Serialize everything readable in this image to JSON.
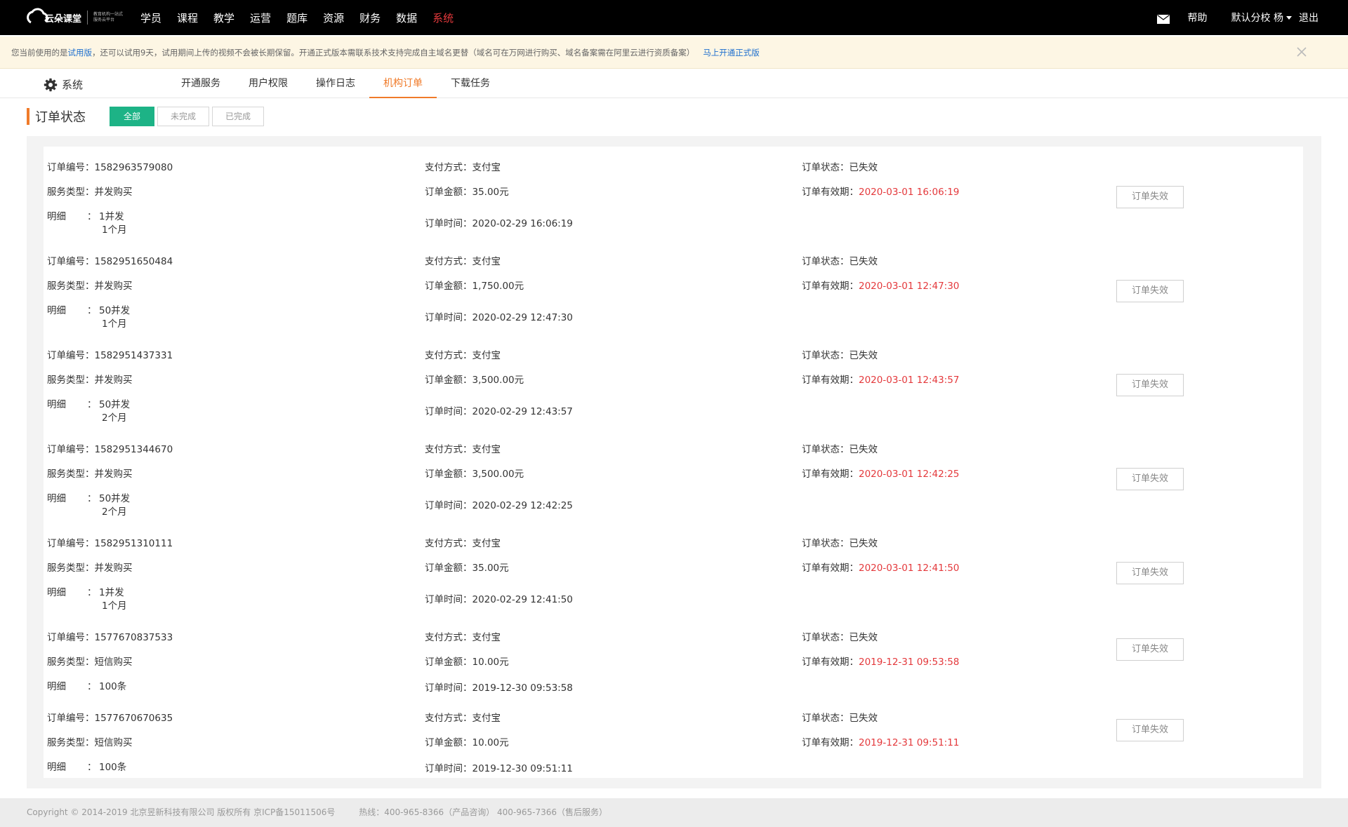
{
  "header": {
    "logo_text": "云朵课堂",
    "logo_slogan": "教育机构一站式服务云平台",
    "nav": [
      "学员",
      "课程",
      "教学",
      "运营",
      "题库",
      "资源",
      "财务",
      "数据",
      "系统"
    ],
    "active_nav": "系统",
    "help": "帮助",
    "school": "默认分校",
    "user": "杨",
    "logout": "退出"
  },
  "notice": {
    "prefix": "您当前使用的是",
    "trial": "试用版",
    "text": "，还可以试用9天，试用期间上传的视频不会被长期保留。开通正式版本需联系技术支持完成自主域名更替（域名可在万网进行购买、域名备案需在阿里云进行资质备案）",
    "upgrade": "马上开通正式版"
  },
  "subnav": {
    "title": "系统",
    "tabs": [
      "开通服务",
      "用户权限",
      "操作日志",
      "机构订单",
      "下载任务"
    ],
    "active_tab": "机构订单"
  },
  "filter": {
    "title": "订单状态",
    "buttons": [
      "全部",
      "未完成",
      "已完成"
    ],
    "active": "全部"
  },
  "labels": {
    "order_no": "订单编号：",
    "service_type": "服务类型：",
    "detail": "明细",
    "detail_colon": "：",
    "pay_method": "支付方式：",
    "amount": "订单金额：",
    "order_time": "订单时间：",
    "status": "订单状态：",
    "valid_until": "订单有效期："
  },
  "orders": [
    {
      "no": "1582963579080",
      "service": "并发购买",
      "detail1": "1并发",
      "detail2": "1个月",
      "pay": "支付宝",
      "amount": "35.00元",
      "time": "2020-02-29 16:06:19",
      "status": "已失效",
      "valid": "2020-03-01 16:06:19",
      "action": "订单失效"
    },
    {
      "no": "1582951650484",
      "service": "并发购买",
      "detail1": "50并发",
      "detail2": "1个月",
      "pay": "支付宝",
      "amount": "1,750.00元",
      "time": "2020-02-29 12:47:30",
      "status": "已失效",
      "valid": "2020-03-01 12:47:30",
      "action": "订单失效"
    },
    {
      "no": "1582951437331",
      "service": "并发购买",
      "detail1": "50并发",
      "detail2": "2个月",
      "pay": "支付宝",
      "amount": "3,500.00元",
      "time": "2020-02-29 12:43:57",
      "status": "已失效",
      "valid": "2020-03-01 12:43:57",
      "action": "订单失效"
    },
    {
      "no": "1582951344670",
      "service": "并发购买",
      "detail1": "50并发",
      "detail2": "2个月",
      "pay": "支付宝",
      "amount": "3,500.00元",
      "time": "2020-02-29 12:42:25",
      "status": "已失效",
      "valid": "2020-03-01 12:42:25",
      "action": "订单失效"
    },
    {
      "no": "1582951310111",
      "service": "并发购买",
      "detail1": "1并发",
      "detail2": "1个月",
      "pay": "支付宝",
      "amount": "35.00元",
      "time": "2020-02-29 12:41:50",
      "status": "已失效",
      "valid": "2020-03-01 12:41:50",
      "action": "订单失效"
    },
    {
      "no": "1577670837533",
      "service": "短信购买",
      "detail1": "100条",
      "detail2": "",
      "pay": "支付宝",
      "amount": "10.00元",
      "time": "2019-12-30 09:53:58",
      "status": "已失效",
      "valid": "2019-12-31 09:53:58",
      "action": "订单失效"
    },
    {
      "no": "1577670670635",
      "service": "短信购买",
      "detail1": "100条",
      "detail2": "",
      "pay": "支付宝",
      "amount": "10.00元",
      "time": "2019-12-30 09:51:11",
      "status": "已失效",
      "valid": "2019-12-31 09:51:11",
      "action": "订单失效"
    }
  ],
  "footer": {
    "copyright": "Copyright © 2014-2019 北京昱新科技有限公司 版权所有 京ICP备15011506号",
    "hotline": "热线：400-965-8366（产品咨询） 400-965-7366（售后服务）"
  },
  "colors": {
    "active_nav": "#e4393c",
    "accent": "#f07b2a",
    "active_filter": "#1db386",
    "expired_date": "#e4393c",
    "link": "#1e6fce"
  }
}
